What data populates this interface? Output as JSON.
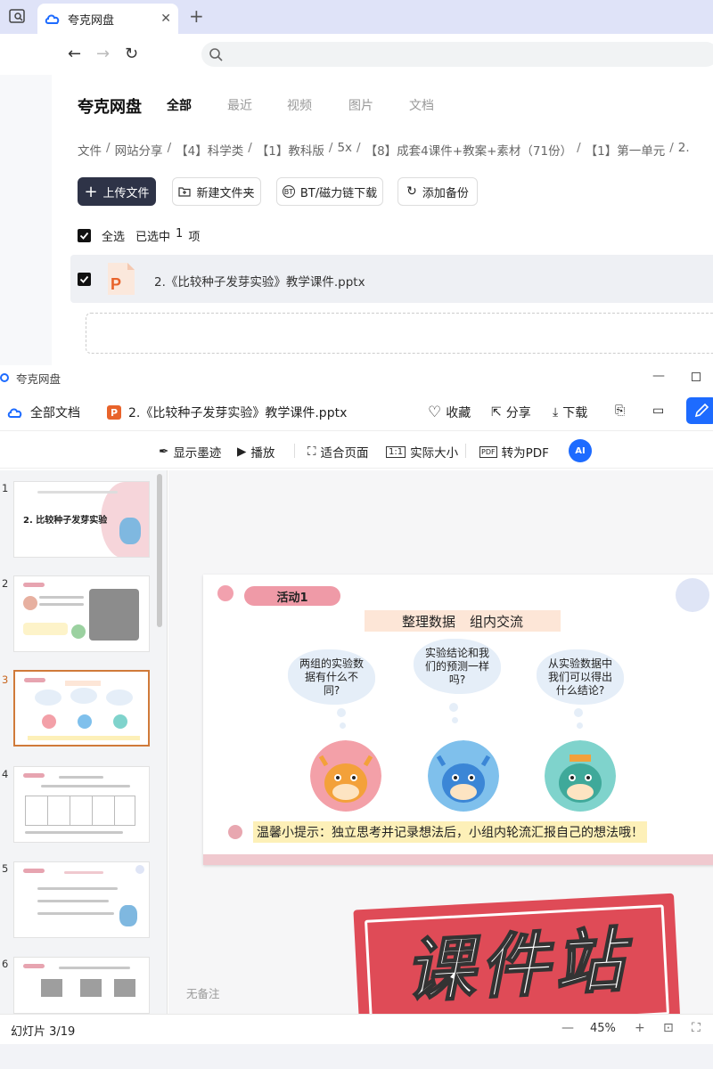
{
  "browser": {
    "tab_title": "夸克网盘",
    "tab_close": "✕",
    "new_tab": "+",
    "back": "←",
    "forward": "→",
    "reload": "↻"
  },
  "disk": {
    "brand": "夸克网盘",
    "tabs": [
      "全部",
      "最近",
      "视频",
      "图片",
      "文档"
    ],
    "breadcrumb": [
      "文件",
      "网站分享",
      "【4】科学类",
      "【1】教科版",
      "5x",
      "【8】成套4课件+教案+素材（71份）",
      "【1】第一单元",
      "2."
    ],
    "toolbar": {
      "upload": "上传文件",
      "new_folder": "新建文件夹",
      "bt_download": "BT/磁力链下载",
      "add_backup": "添加备份"
    },
    "selection": {
      "select_all": "全选",
      "selected": "已选中",
      "count": "1",
      "unit": "项"
    },
    "file_name": "2.《比较种子发芽实验》教学课件.pptx"
  },
  "viewer": {
    "window_title": "夸克网盘",
    "all_docs": "全部文档",
    "doc_name": "2.《比较种子发芽实验》教学课件.pptx",
    "actions": [
      "收藏",
      "分享",
      "下载"
    ],
    "tools": [
      "显示墨迹",
      "播放",
      "适合页面",
      "实际大小",
      "转为PDF"
    ],
    "ai_label": "AI",
    "thumb_numbers": [
      "1",
      "2",
      "3",
      "4",
      "5",
      "6"
    ],
    "thumb1_title": "2. 比较种子发芽实验",
    "slide": {
      "activity": "活动1",
      "heading_a": "整理数据",
      "heading_b": "组内交流",
      "q1": "两组的实验数据有什么不同?",
      "q2": "实验结论和我们的预测一样吗?",
      "q3": "从实验数据中我们可以得出什么结论?",
      "tip": "温馨小提示：独立思考并记录想法后，小组内轮流汇报自己的想法哦！"
    },
    "notes_placeholder": "无备注",
    "slide_counter": "幻灯片 3/19",
    "zoom": "45%",
    "watermark": "课件站"
  },
  "colors": {
    "accent_blue": "#1d6bff",
    "upload_btn": "#2e3347",
    "ppt_orange": "#e8632b",
    "pink": "#ef9aa7",
    "stamp_red": "#df4b57"
  }
}
